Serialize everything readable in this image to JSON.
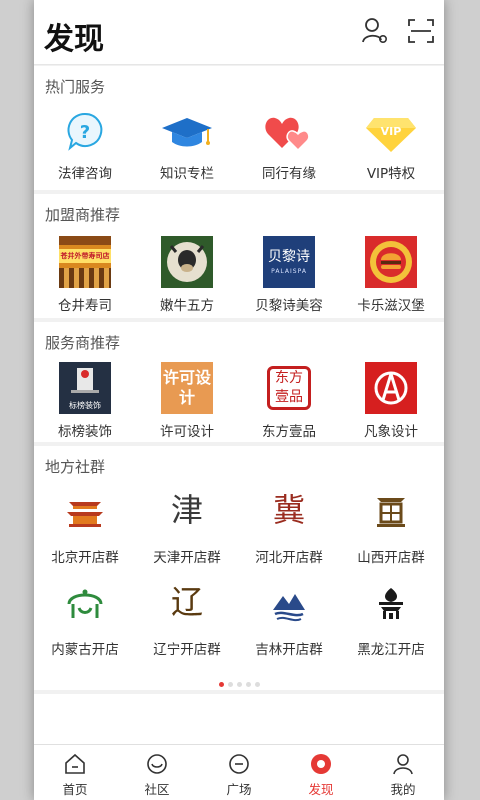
{
  "header": {
    "title": "发现"
  },
  "hot": {
    "title": "热门服务",
    "items": [
      {
        "label": "法律咨询"
      },
      {
        "label": "知识专栏"
      },
      {
        "label": "同行有缘"
      },
      {
        "label": "VIP特权",
        "badge": "VIP"
      }
    ]
  },
  "franchise": {
    "title": "加盟商推荐",
    "items": [
      {
        "label": "仓井寿司",
        "logo_text": "苍井外带寿司店"
      },
      {
        "label": "嫩牛五方"
      },
      {
        "label": "贝黎诗美容",
        "logo_text": "贝黎诗",
        "logo_sub": "PALAISPA"
      },
      {
        "label": "卡乐滋汉堡"
      }
    ]
  },
  "provider": {
    "title": "服务商推荐",
    "items": [
      {
        "label": "标榜装饰",
        "logo_text": "标榜装饰"
      },
      {
        "label": "许可设计",
        "logo_text": "许可设计"
      },
      {
        "label": "东方壹品",
        "logo_text": "东方壹品"
      },
      {
        "label": "凡象设计"
      }
    ]
  },
  "local": {
    "title": "地方社群",
    "items": [
      {
        "label": "北京开店群"
      },
      {
        "label": "天津开店群",
        "glyph": "津"
      },
      {
        "label": "河北开店群",
        "glyph": "冀"
      },
      {
        "label": "山西开店群"
      },
      {
        "label": "内蒙古开店"
      },
      {
        "label": "辽宁开店群",
        "glyph": "辽"
      },
      {
        "label": "吉林开店群"
      },
      {
        "label": "黑龙江开店"
      }
    ]
  },
  "tabs": [
    {
      "label": "首页"
    },
    {
      "label": "社区"
    },
    {
      "label": "广场"
    },
    {
      "label": "发现",
      "active": true
    },
    {
      "label": "我的"
    }
  ],
  "colors": {
    "accent": "#e53935",
    "section_title": "#555555",
    "background": "#f1f1f1"
  }
}
